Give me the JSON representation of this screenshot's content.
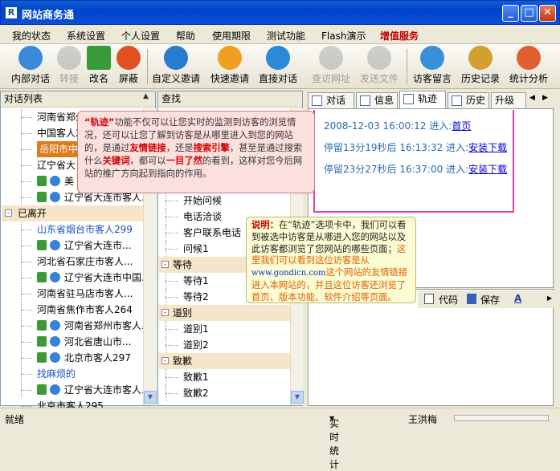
{
  "window": {
    "title": "网站商务通"
  },
  "menu": [
    "我的状态",
    "系统设置",
    "个人设置",
    "帮助",
    "使用期限",
    "测试功能",
    "Flash演示",
    "增值服务"
  ],
  "toolbar": [
    {
      "label": "内部对话",
      "color": "#3a8ad8",
      "disabled": false
    },
    {
      "label": "转接",
      "color": "#808080",
      "disabled": true
    },
    {
      "label": "改名",
      "color": "#3a9a3a",
      "disabled": false
    },
    {
      "label": "屏蔽",
      "color": "#e05020",
      "disabled": false
    },
    {
      "label": "自定义邀请",
      "color": "#2a7ad0",
      "disabled": false
    },
    {
      "label": "快速邀请",
      "color": "#f0a020",
      "disabled": false
    },
    {
      "label": "直接对话",
      "color": "#2a8ad8",
      "disabled": false
    },
    {
      "label": "查访网址",
      "color": "#808080",
      "disabled": true
    },
    {
      "label": "发送文件",
      "color": "#808080",
      "disabled": true
    },
    {
      "label": "访客留言",
      "color": "#3a90d8",
      "disabled": false
    },
    {
      "label": "历史记录",
      "color": "#d0a030",
      "disabled": false
    },
    {
      "label": "统计分析",
      "color": "#e06030",
      "disabled": false
    }
  ],
  "left_panel": {
    "title": "对话列表",
    "rows": [
      {
        "text": "河南省郑州",
        "indent": 44,
        "type": "item"
      },
      {
        "text": "中国客人2",
        "indent": 44,
        "type": "item"
      },
      {
        "text": "岳阳市中",
        "indent": 44,
        "type": "selected"
      },
      {
        "text": "辽宁省大",
        "indent": 44,
        "type": "item"
      },
      {
        "text": "美",
        "indent": 44,
        "type": "icons"
      },
      {
        "text": "辽宁省大连市客人...",
        "indent": 44,
        "type": "icons"
      },
      {
        "text": "已离开",
        "indent": 4,
        "type": "group"
      },
      {
        "text": "山东省烟台市客人299",
        "indent": 44,
        "type": "link"
      },
      {
        "text": "辽宁省大连市...",
        "indent": 44,
        "type": "icons"
      },
      {
        "text": "河北省石家庄市客人...",
        "indent": 44,
        "type": "item"
      },
      {
        "text": "辽宁省大连市中国...",
        "indent": 44,
        "type": "icons"
      },
      {
        "text": "河南省驻马店市客人...",
        "indent": 44,
        "type": "item"
      },
      {
        "text": "河南省焦作市客人264",
        "indent": 44,
        "type": "item"
      },
      {
        "text": "河南省郑州市客人...",
        "indent": 44,
        "type": "icons"
      },
      {
        "text": "河北省唐山市...",
        "indent": 44,
        "type": "icons"
      },
      {
        "text": "北京市客人297",
        "indent": 44,
        "type": "icons"
      },
      {
        "text": "找麻烦的",
        "indent": 44,
        "type": "link"
      },
      {
        "text": "辽宁省大连市客人...",
        "indent": 44,
        "type": "icons"
      },
      {
        "text": "北京市客人295",
        "indent": 44,
        "type": "item"
      }
    ]
  },
  "mid_panel": {
    "title": "查找",
    "rows": [
      {
        "text": "开始问候",
        "type": "item"
      },
      {
        "text": "电话洽谈",
        "type": "item"
      },
      {
        "text": "客户联系电话",
        "type": "item"
      },
      {
        "text": "问候1",
        "type": "item"
      },
      {
        "text": "等待",
        "type": "group"
      },
      {
        "text": "等待1",
        "type": "item"
      },
      {
        "text": "等待2",
        "type": "item"
      },
      {
        "text": "道别",
        "type": "group"
      },
      {
        "text": "道别1",
        "type": "item"
      },
      {
        "text": "道别2",
        "type": "item"
      },
      {
        "text": "致歉",
        "type": "group"
      },
      {
        "text": "致歉1",
        "type": "item"
      },
      {
        "text": "致歉2",
        "type": "item"
      }
    ]
  },
  "tabs": [
    "对话",
    "信息",
    "轨迹",
    "历史",
    "升级"
  ],
  "track": [
    {
      "prefix": "2008-12-03 16:00:12 进入:",
      "link": "首页"
    },
    {
      "prefix": "停留13分19秒后 16:13:32 进入:",
      "link": "安装下载"
    },
    {
      "prefix": "停留23分27秒后 16:37:00 进入:",
      "link": "安装下载"
    }
  ],
  "callout1": {
    "t1": "“轨迹”",
    "t2": "功能不仅可以让您实时的监测到访客的浏览情况，还可以让您了解到访客是从哪里进入到您的网站的，是通过",
    "t3": "友情链接",
    "t4": "，还是",
    "t5": "搜索引擎",
    "t6": "，甚至是通过搜索什么",
    "t7": "关键词",
    "t8": "，都可以",
    "t9": "一目了然",
    "t10": "的看到，这样对您今后网站的推广方向起到指向的作用。"
  },
  "callout2": {
    "t1": "说明：",
    "t2": "在“轨迹”选项卡中，我们可以看到被选中访客是从哪进入您的网站以及此访客都浏览了您网站的哪些页面；",
    "t3": "这里我们可以看到这位访客是从",
    "t4": "www.gondicn.com",
    "t5": "这个网站的友情链接进入本网站的，并且这位访客还浏览了首页、版本功能、软件介绍等页面。"
  },
  "edit_toolbar": {
    "code": "代码",
    "save": "保存"
  },
  "status": {
    "ready": "就绪",
    "stats": "实时统计",
    "user": "王洪梅"
  }
}
